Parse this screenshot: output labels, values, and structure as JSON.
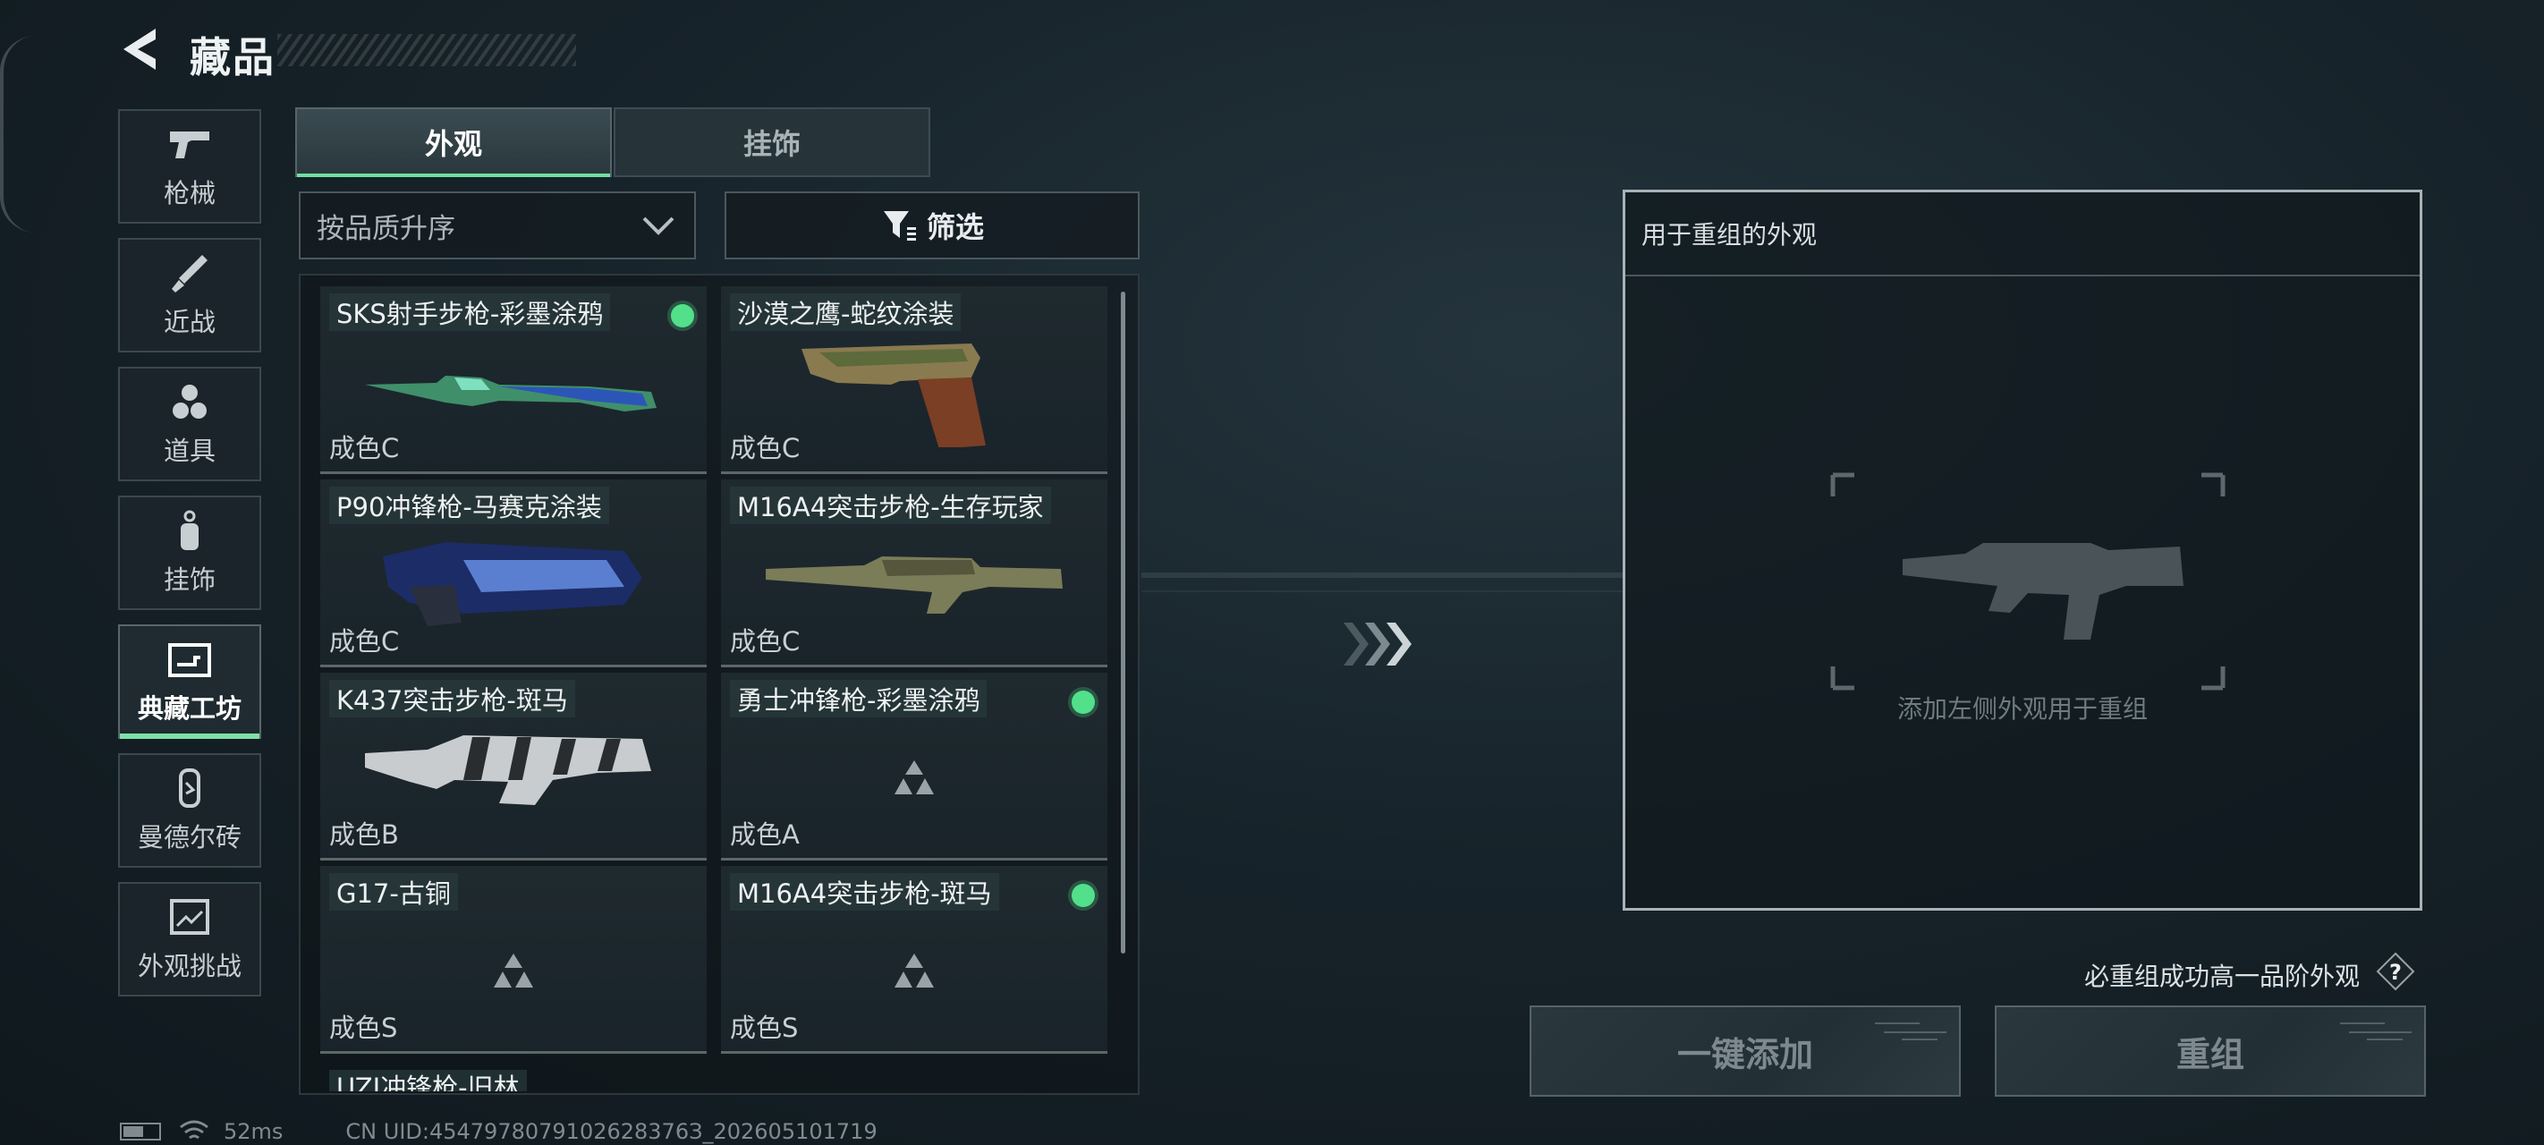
{
  "header": {
    "title": "藏品"
  },
  "sidebar": {
    "items": [
      {
        "label": "枪械",
        "icon": "pistol-icon"
      },
      {
        "label": "近战",
        "icon": "knife-icon"
      },
      {
        "label": "道具",
        "icon": "grenades-icon"
      },
      {
        "label": "挂饰",
        "icon": "charm-icon"
      },
      {
        "label": "典藏工坊",
        "icon": "workshop-icon",
        "active": true
      },
      {
        "label": "曼德尔砖",
        "icon": "mandel-brick-icon"
      },
      {
        "label": "外观挑战",
        "icon": "challenge-icon"
      }
    ]
  },
  "tabs": [
    {
      "label": "外观",
      "active": true
    },
    {
      "label": "挂饰",
      "active": false
    }
  ],
  "sort": {
    "label": "按品质升序"
  },
  "filter": {
    "label": "筛选"
  },
  "items": [
    {
      "name": "SKS射手步枪-彩墨涂鸦",
      "grade": "成色C",
      "new_dot": true
    },
    {
      "name": "沙漠之鹰-蛇纹涂装",
      "grade": "成色C",
      "new_dot": false
    },
    {
      "name": "P90冲锋枪-马赛克涂装",
      "grade": "成色C",
      "new_dot": false
    },
    {
      "name": "M16A4突击步枪-生存玩家",
      "grade": "成色C",
      "new_dot": false
    },
    {
      "name": "K437突击步枪-斑马",
      "grade": "成色B",
      "new_dot": false
    },
    {
      "name": "勇士冲锋枪-彩墨涂鸦",
      "grade": "成色A",
      "new_dot": true
    },
    {
      "name": "G17-古铜",
      "grade": "成色S",
      "new_dot": false
    },
    {
      "name": "M16A4突击步枪-斑马",
      "grade": "成色S",
      "new_dot": true
    },
    {
      "name": "UZI冲锋枪-旧林",
      "grade": "",
      "new_dot": false
    }
  ],
  "remix": {
    "title": "用于重组的外观",
    "hint": "添加左侧外观用于重组",
    "note": "必重组成功高一品阶外观",
    "help": "?",
    "add_button": "一键添加",
    "remix_button": "重组"
  },
  "status": {
    "ping": "52ms",
    "uid": "CN UID:4547978079102628376З_202605101719"
  },
  "colors": {
    "accent": "#6fe0a0",
    "new_dot": "#52e08a",
    "background": "#17232a"
  }
}
